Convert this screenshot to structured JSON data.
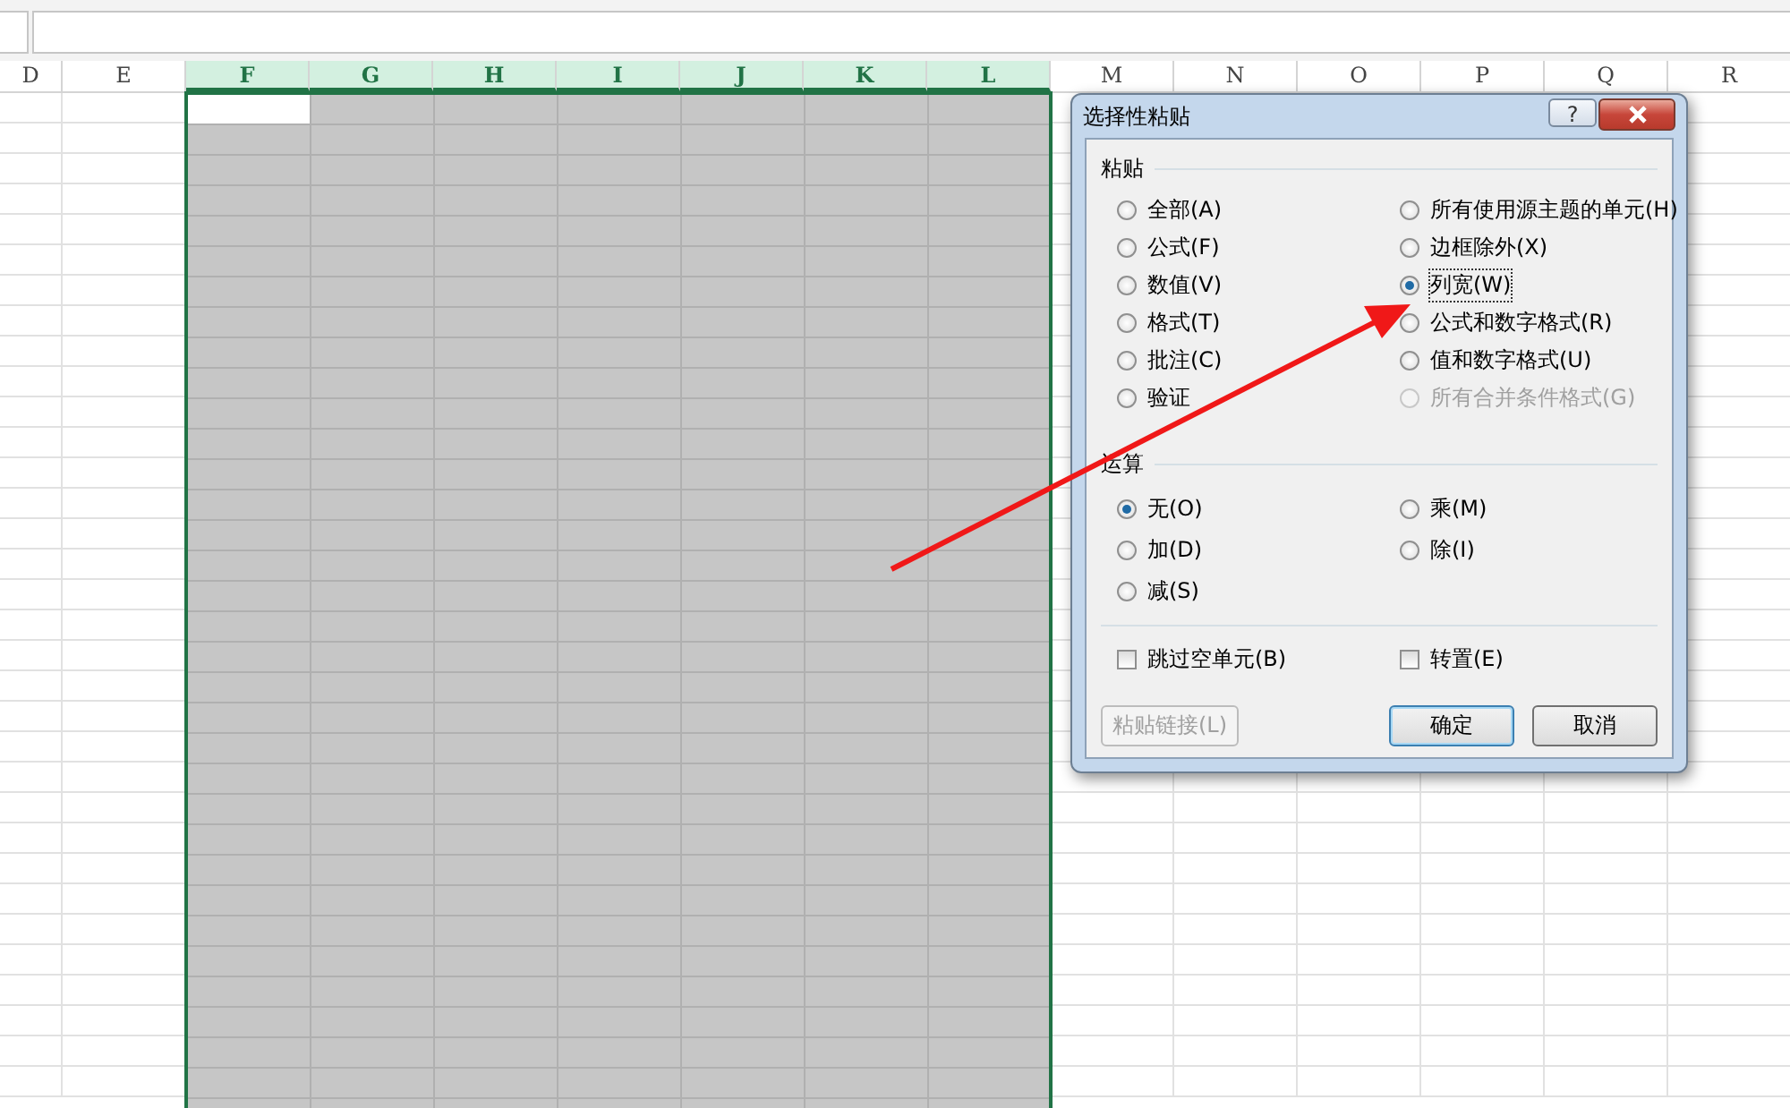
{
  "columns": [
    {
      "label": "D",
      "selected": false
    },
    {
      "label": "E",
      "selected": false
    },
    {
      "label": "F",
      "selected": true
    },
    {
      "label": "G",
      "selected": true
    },
    {
      "label": "H",
      "selected": true
    },
    {
      "label": "I",
      "selected": true
    },
    {
      "label": "J",
      "selected": true
    },
    {
      "label": "K",
      "selected": true
    },
    {
      "label": "L",
      "selected": true
    },
    {
      "label": "M",
      "selected": false
    },
    {
      "label": "N",
      "selected": false
    },
    {
      "label": "O",
      "selected": false
    },
    {
      "label": "P",
      "selected": false
    },
    {
      "label": "Q",
      "selected": false
    },
    {
      "label": "R",
      "selected": false
    }
  ],
  "dialog": {
    "title": "选择性粘贴",
    "help": "?",
    "paste": {
      "title": "粘贴",
      "options": [
        {
          "label": "全部(A)",
          "selected": false,
          "disabled": false
        },
        {
          "label": "所有使用源主题的单元(H)",
          "selected": false,
          "disabled": false
        },
        {
          "label": "公式(F)",
          "selected": false,
          "disabled": false
        },
        {
          "label": "边框除外(X)",
          "selected": false,
          "disabled": false
        },
        {
          "label": "数值(V)",
          "selected": false,
          "disabled": false
        },
        {
          "label": "列宽(W)",
          "selected": true,
          "disabled": false
        },
        {
          "label": "格式(T)",
          "selected": false,
          "disabled": false
        },
        {
          "label": "公式和数字格式(R)",
          "selected": false,
          "disabled": false
        },
        {
          "label": "批注(C)",
          "selected": false,
          "disabled": false
        },
        {
          "label": "值和数字格式(U)",
          "selected": false,
          "disabled": false
        },
        {
          "label": "验证",
          "selected": false,
          "disabled": false
        },
        {
          "label": "所有合并条件格式(G)",
          "selected": false,
          "disabled": true
        }
      ]
    },
    "operation": {
      "title": "运算",
      "options": [
        {
          "label": "无(O)",
          "selected": true,
          "disabled": false
        },
        {
          "label": "乘(M)",
          "selected": false,
          "disabled": false
        },
        {
          "label": "加(D)",
          "selected": false,
          "disabled": false
        },
        {
          "label": "除(I)",
          "selected": false,
          "disabled": false
        },
        {
          "label": "减(S)",
          "selected": false,
          "disabled": false
        }
      ]
    },
    "checkboxes": [
      {
        "label": "跳过空单元(B)",
        "checked": false
      },
      {
        "label": "转置(E)",
        "checked": false
      }
    ],
    "buttons": [
      {
        "label": "粘贴链接(L)",
        "disabled": true,
        "default": false
      },
      {
        "label": "确定",
        "disabled": false,
        "default": true
      },
      {
        "label": "取消",
        "disabled": false,
        "default": false
      }
    ]
  }
}
